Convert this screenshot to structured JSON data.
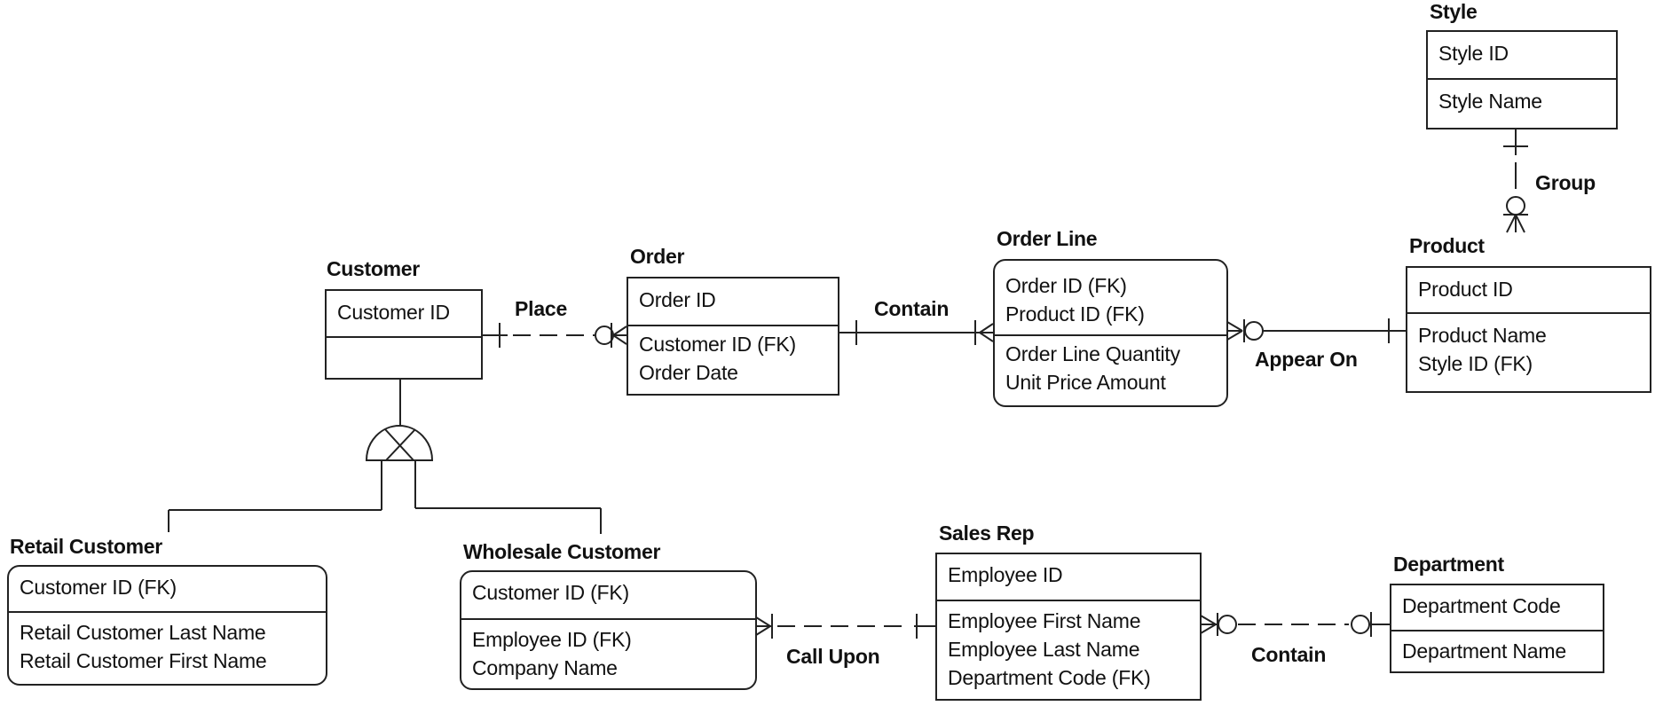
{
  "diagram": {
    "notation": "IDEF1X / Information Engineering ER diagram",
    "entities": {
      "customer": {
        "name": "Customer",
        "keys": [
          "Customer ID"
        ],
        "attributes": []
      },
      "order": {
        "name": "Order",
        "keys": [
          "Order ID"
        ],
        "attributes": [
          "Customer ID (FK)",
          "Order Date"
        ]
      },
      "order_line": {
        "name": "Order Line",
        "keys": [
          "Order ID (FK)",
          "Product ID (FK)"
        ],
        "attributes": [
          "Order Line Quantity",
          "Unit Price Amount"
        ]
      },
      "product": {
        "name": "Product",
        "keys": [
          "Product ID"
        ],
        "attributes": [
          "Product Name",
          "Style ID (FK)"
        ]
      },
      "style": {
        "name": "Style",
        "keys": [
          "Style ID"
        ],
        "attributes": [
          "Style Name"
        ]
      },
      "retail_customer": {
        "name": "Retail Customer",
        "keys": [
          "Customer ID (FK)"
        ],
        "attributes": [
          "Retail Customer Last Name",
          "Retail Customer First Name"
        ]
      },
      "wholesale_customer": {
        "name": "Wholesale Customer",
        "keys": [
          "Customer ID (FK)"
        ],
        "attributes": [
          "Employee ID (FK)",
          "Company Name"
        ]
      },
      "sales_rep": {
        "name": "Sales Rep",
        "keys": [
          "Employee ID"
        ],
        "attributes": [
          "Employee First Name",
          "Employee Last Name",
          "Department Code (FK)"
        ]
      },
      "department": {
        "name": "Department",
        "keys": [
          "Department Code"
        ],
        "attributes": [
          "Department Name"
        ]
      }
    },
    "relationships": {
      "place": {
        "label": "Place",
        "from": "Customer",
        "to": "Order",
        "line": "dashed",
        "from_end": "one",
        "to_end": "zero-or-many"
      },
      "contain_order": {
        "label": "Contain",
        "from": "Order",
        "to": "Order Line",
        "line": "solid",
        "from_end": "one",
        "to_end": "one-or-many"
      },
      "appear_on": {
        "label": "Appear On",
        "from": "Product",
        "to": "Order Line",
        "line": "solid",
        "from_end": "one",
        "to_end": "zero-or-many"
      },
      "group": {
        "label": "Group",
        "from": "Style",
        "to": "Product",
        "line": "dashed",
        "from_end": "one",
        "to_end": "zero-or-many"
      },
      "call_upon": {
        "label": "Call Upon",
        "from": "Sales Rep",
        "to": "Wholesale Customer",
        "line": "dashed",
        "from_end": "one",
        "to_end": "one-or-many"
      },
      "contain_dept": {
        "label": "Contain",
        "from": "Department",
        "to": "Sales Rep",
        "line": "dashed",
        "from_end": "zero-or-one",
        "to_end": "zero-or-many"
      }
    },
    "subtype": {
      "supertype": "Customer",
      "subtypes": [
        "Retail Customer",
        "Wholesale Customer"
      ],
      "kind": "exclusive"
    },
    "colors": {
      "line": "#222222",
      "background": "#ffffff",
      "text": "#111111"
    }
  }
}
